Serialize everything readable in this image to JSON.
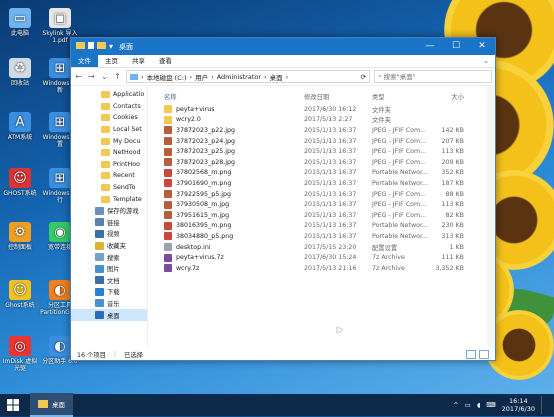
{
  "desktop_icons": [
    {
      "label": "此电脑",
      "icon": "pc-icon",
      "color": "#6fb3f0"
    },
    {
      "label": "Skylink 导入 1.pdf",
      "icon": "window-icon",
      "color": "#e6e6e6"
    },
    {
      "label": "回收站",
      "icon": "recycle-icon",
      "color": "#cfd8e3"
    },
    {
      "label": "Windows 更新",
      "icon": "windows-icon",
      "color": "#3a8fe0"
    },
    {
      "label": "ATM系统",
      "icon": "a-icon",
      "color": "#3a8fe0"
    },
    {
      "label": "Windows 设置",
      "icon": "windows-icon",
      "color": "#3a8fe0"
    },
    {
      "label": "GHOST系统",
      "icon": "ghost-icon",
      "color": "#d33"
    },
    {
      "label": "Windows 运行",
      "icon": "windows-icon",
      "color": "#3a8fe0"
    },
    {
      "label": "控制面板",
      "icon": "gear-icon",
      "color": "#f0a020"
    },
    {
      "label": "宽带连接",
      "icon": "network-icon",
      "color": "#3c6"
    },
    {
      "label": "Ghost系统",
      "icon": "ghost-icon",
      "color": "#f0c020"
    },
    {
      "label": "分区工具 PartitionGuru",
      "icon": "partition-icon",
      "color": "#f08020"
    },
    {
      "label": "ImDisk 虚拟光驱",
      "icon": "disc-icon",
      "color": "#e33"
    },
    {
      "label": "分区助手 6.0",
      "icon": "partition-icon",
      "color": "#3a8fe0"
    }
  ],
  "window": {
    "title": "桌面",
    "ribbon_tabs": [
      "文件",
      "主页",
      "共享",
      "查看"
    ],
    "address": [
      "本地磁盘 (C:)",
      "用户",
      "Administrator",
      "桌面"
    ],
    "search_placeholder": "搜索\"桌面\"",
    "columns": {
      "name": "名称",
      "date": "修改日期",
      "type": "类型",
      "size": "大小"
    },
    "nav_items": [
      {
        "label": "Applicatio",
        "kind": "folder"
      },
      {
        "label": "Contacts",
        "kind": "folder"
      },
      {
        "label": "Cookies",
        "kind": "folder"
      },
      {
        "label": "Local Set",
        "kind": "folder"
      },
      {
        "label": "My Docu",
        "kind": "folder"
      },
      {
        "label": "NetHood",
        "kind": "folder"
      },
      {
        "label": "PrintHoo",
        "kind": "folder"
      },
      {
        "label": "Recent",
        "kind": "folder"
      },
      {
        "label": "SendTo",
        "kind": "folder"
      },
      {
        "label": "Template",
        "kind": "folder"
      },
      {
        "label": "保存的游戏",
        "kind": "special"
      },
      {
        "label": "链接",
        "kind": "special"
      },
      {
        "label": "视频",
        "kind": "special"
      },
      {
        "label": "收藏夹",
        "kind": "special"
      },
      {
        "label": "搜索",
        "kind": "special"
      },
      {
        "label": "图片",
        "kind": "special"
      },
      {
        "label": "文档",
        "kind": "special"
      },
      {
        "label": "下载",
        "kind": "special"
      },
      {
        "label": "音乐",
        "kind": "special"
      },
      {
        "label": "桌面",
        "kind": "selected"
      }
    ],
    "files": [
      {
        "name": "peyta+virus",
        "date": "2017/6/30 16:12",
        "type": "文件夹",
        "size": "",
        "kind": "folder"
      },
      {
        "name": "wcry2.0",
        "date": "2017/5/13 2:27",
        "type": "文件夹",
        "size": "",
        "kind": "folder"
      },
      {
        "name": "37872023_p22.jpg",
        "date": "2015/1/13 16:37",
        "type": "JPEG - JFIF Com...",
        "size": "142 KB",
        "kind": "jpg"
      },
      {
        "name": "37872023_p24.jpg",
        "date": "2015/1/13 16:37",
        "type": "JPEG - JFIF Com...",
        "size": "207 KB",
        "kind": "jpg"
      },
      {
        "name": "37872023_p25.jpg",
        "date": "2015/1/13 16:37",
        "type": "JPEG - JFIF Com...",
        "size": "113 KB",
        "kind": "jpg"
      },
      {
        "name": "37872023_p28.jpg",
        "date": "2015/1/13 16:37",
        "type": "JPEG - JFIF Com...",
        "size": "209 KB",
        "kind": "jpg"
      },
      {
        "name": "37802568_m.png",
        "date": "2015/1/13 16:37",
        "type": "Portable Networ...",
        "size": "352 KB",
        "kind": "png"
      },
      {
        "name": "37901690_m.png",
        "date": "2015/1/13 16:37",
        "type": "Portable Networ...",
        "size": "187 KB",
        "kind": "png"
      },
      {
        "name": "37922595_p5.jpg",
        "date": "2015/1/13 16:37",
        "type": "JPEG - JFIF Com...",
        "size": "88 KB",
        "kind": "jpg"
      },
      {
        "name": "37930508_m.jpg",
        "date": "2015/1/13 16:37",
        "type": "JPEG - JFIF Com...",
        "size": "113 KB",
        "kind": "jpg"
      },
      {
        "name": "37951615_m.jpg",
        "date": "2015/1/13 16:37",
        "type": "JPEG - JFIF Com...",
        "size": "82 KB",
        "kind": "jpg"
      },
      {
        "name": "38016395_m.png",
        "date": "2015/1/13 16:37",
        "type": "Portable Networ...",
        "size": "230 KB",
        "kind": "png"
      },
      {
        "name": "38034880_p5.png",
        "date": "2015/1/13 16:37",
        "type": "Portable Networ...",
        "size": "313 KB",
        "kind": "png"
      },
      {
        "name": "desktop.ini",
        "date": "2017/5/15 23:20",
        "type": "配置设置",
        "size": "1 KB",
        "kind": "ini"
      },
      {
        "name": "peyta+virus.7z",
        "date": "2017/6/30 15:24",
        "type": "7z Archive",
        "size": "111 KB",
        "kind": "7z"
      },
      {
        "name": "wcry.7z",
        "date": "2017/5/13 21:16",
        "type": "7z Archive",
        "size": "3,352 KB",
        "kind": "7z"
      }
    ],
    "status": {
      "count": "16 个项目",
      "selected": "已选择"
    }
  },
  "taskbar": {
    "app_label": "桌面",
    "time": "16:14",
    "date": "2017/6/30"
  },
  "colors": {
    "accent": "#1a74c8",
    "folder": "#f2c955",
    "jpg": "#b85c3a",
    "png": "#c9473b",
    "archive": "#7a4aa0"
  }
}
